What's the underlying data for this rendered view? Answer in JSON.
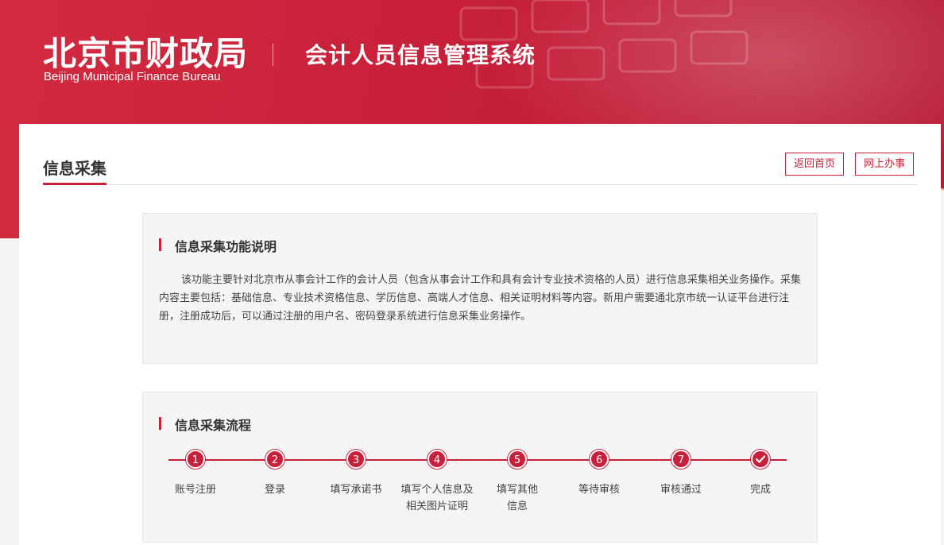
{
  "header": {
    "logo_cn": "北京市财政局",
    "logo_en": "Beijing Municipal Finance Bureau",
    "system_title": "会计人员信息管理系统"
  },
  "page": {
    "title": "信息采集",
    "buttons": {
      "home": "返回首页",
      "online": "网上办事"
    }
  },
  "description": {
    "heading": "信息采集功能说明",
    "text": "该功能主要针对北京市从事会计工作的会计人员（包含从事会计工作和具有会计专业技术资格的人员）进行信息采集相关业务操作。采集内容主要包括：基础信息、专业技术资格信息、学历信息、高端人才信息、相关证明材料等内容。新用户需要通北京市统一认证平台进行注册，注册成功后，可以通过注册的用户名、密码登录系统进行信息采集业务操作。"
  },
  "flow": {
    "heading": "信息采集流程",
    "steps": [
      {
        "num": "1",
        "label": "账号注册"
      },
      {
        "num": "2",
        "label": "登录"
      },
      {
        "num": "3",
        "label": "填写承诺书"
      },
      {
        "num": "4",
        "label": "填写个人信息及相关图片证明"
      },
      {
        "num": "5",
        "label": "填写其他信息"
      },
      {
        "num": "6",
        "label": "等待审核"
      },
      {
        "num": "7",
        "label": "审核通过"
      },
      {
        "num": "",
        "label": "完成",
        "icon": "check-icon"
      }
    ]
  },
  "colors": {
    "accent": "#c8203a",
    "panel_bg": "#f5f5f5"
  }
}
